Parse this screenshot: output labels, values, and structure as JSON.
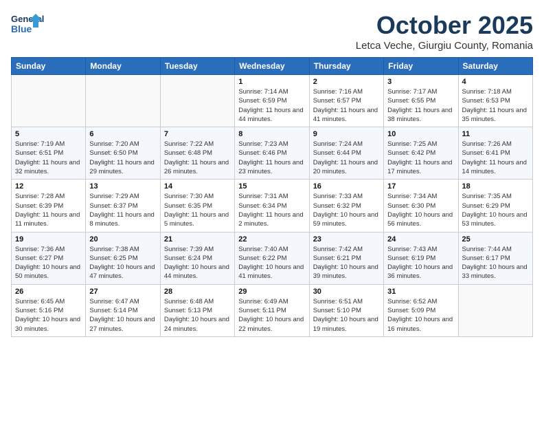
{
  "header": {
    "logo_line1": "General",
    "logo_line2": "Blue",
    "month_title": "October 2025",
    "location": "Letca Veche, Giurgiu County, Romania"
  },
  "days_of_week": [
    "Sunday",
    "Monday",
    "Tuesday",
    "Wednesday",
    "Thursday",
    "Friday",
    "Saturday"
  ],
  "weeks": [
    [
      {
        "day": "",
        "info": ""
      },
      {
        "day": "",
        "info": ""
      },
      {
        "day": "",
        "info": ""
      },
      {
        "day": "1",
        "info": "Sunrise: 7:14 AM\nSunset: 6:59 PM\nDaylight: 11 hours and 44 minutes."
      },
      {
        "day": "2",
        "info": "Sunrise: 7:16 AM\nSunset: 6:57 PM\nDaylight: 11 hours and 41 minutes."
      },
      {
        "day": "3",
        "info": "Sunrise: 7:17 AM\nSunset: 6:55 PM\nDaylight: 11 hours and 38 minutes."
      },
      {
        "day": "4",
        "info": "Sunrise: 7:18 AM\nSunset: 6:53 PM\nDaylight: 11 hours and 35 minutes."
      }
    ],
    [
      {
        "day": "5",
        "info": "Sunrise: 7:19 AM\nSunset: 6:51 PM\nDaylight: 11 hours and 32 minutes."
      },
      {
        "day": "6",
        "info": "Sunrise: 7:20 AM\nSunset: 6:50 PM\nDaylight: 11 hours and 29 minutes."
      },
      {
        "day": "7",
        "info": "Sunrise: 7:22 AM\nSunset: 6:48 PM\nDaylight: 11 hours and 26 minutes."
      },
      {
        "day": "8",
        "info": "Sunrise: 7:23 AM\nSunset: 6:46 PM\nDaylight: 11 hours and 23 minutes."
      },
      {
        "day": "9",
        "info": "Sunrise: 7:24 AM\nSunset: 6:44 PM\nDaylight: 11 hours and 20 minutes."
      },
      {
        "day": "10",
        "info": "Sunrise: 7:25 AM\nSunset: 6:42 PM\nDaylight: 11 hours and 17 minutes."
      },
      {
        "day": "11",
        "info": "Sunrise: 7:26 AM\nSunset: 6:41 PM\nDaylight: 11 hours and 14 minutes."
      }
    ],
    [
      {
        "day": "12",
        "info": "Sunrise: 7:28 AM\nSunset: 6:39 PM\nDaylight: 11 hours and 11 minutes."
      },
      {
        "day": "13",
        "info": "Sunrise: 7:29 AM\nSunset: 6:37 PM\nDaylight: 11 hours and 8 minutes."
      },
      {
        "day": "14",
        "info": "Sunrise: 7:30 AM\nSunset: 6:35 PM\nDaylight: 11 hours and 5 minutes."
      },
      {
        "day": "15",
        "info": "Sunrise: 7:31 AM\nSunset: 6:34 PM\nDaylight: 11 hours and 2 minutes."
      },
      {
        "day": "16",
        "info": "Sunrise: 7:33 AM\nSunset: 6:32 PM\nDaylight: 10 hours and 59 minutes."
      },
      {
        "day": "17",
        "info": "Sunrise: 7:34 AM\nSunset: 6:30 PM\nDaylight: 10 hours and 56 minutes."
      },
      {
        "day": "18",
        "info": "Sunrise: 7:35 AM\nSunset: 6:29 PM\nDaylight: 10 hours and 53 minutes."
      }
    ],
    [
      {
        "day": "19",
        "info": "Sunrise: 7:36 AM\nSunset: 6:27 PM\nDaylight: 10 hours and 50 minutes."
      },
      {
        "day": "20",
        "info": "Sunrise: 7:38 AM\nSunset: 6:25 PM\nDaylight: 10 hours and 47 minutes."
      },
      {
        "day": "21",
        "info": "Sunrise: 7:39 AM\nSunset: 6:24 PM\nDaylight: 10 hours and 44 minutes."
      },
      {
        "day": "22",
        "info": "Sunrise: 7:40 AM\nSunset: 6:22 PM\nDaylight: 10 hours and 41 minutes."
      },
      {
        "day": "23",
        "info": "Sunrise: 7:42 AM\nSunset: 6:21 PM\nDaylight: 10 hours and 39 minutes."
      },
      {
        "day": "24",
        "info": "Sunrise: 7:43 AM\nSunset: 6:19 PM\nDaylight: 10 hours and 36 minutes."
      },
      {
        "day": "25",
        "info": "Sunrise: 7:44 AM\nSunset: 6:17 PM\nDaylight: 10 hours and 33 minutes."
      }
    ],
    [
      {
        "day": "26",
        "info": "Sunrise: 6:45 AM\nSunset: 5:16 PM\nDaylight: 10 hours and 30 minutes."
      },
      {
        "day": "27",
        "info": "Sunrise: 6:47 AM\nSunset: 5:14 PM\nDaylight: 10 hours and 27 minutes."
      },
      {
        "day": "28",
        "info": "Sunrise: 6:48 AM\nSunset: 5:13 PM\nDaylight: 10 hours and 24 minutes."
      },
      {
        "day": "29",
        "info": "Sunrise: 6:49 AM\nSunset: 5:11 PM\nDaylight: 10 hours and 22 minutes."
      },
      {
        "day": "30",
        "info": "Sunrise: 6:51 AM\nSunset: 5:10 PM\nDaylight: 10 hours and 19 minutes."
      },
      {
        "day": "31",
        "info": "Sunrise: 6:52 AM\nSunset: 5:09 PM\nDaylight: 10 hours and 16 minutes."
      },
      {
        "day": "",
        "info": ""
      }
    ]
  ]
}
